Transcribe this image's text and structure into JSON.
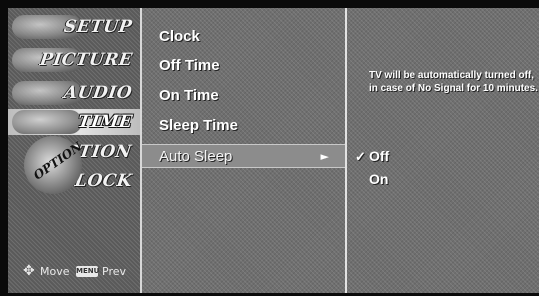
{
  "sidebar": {
    "items": [
      {
        "label": "SETUP"
      },
      {
        "label": "PICTURE"
      },
      {
        "label": "AUDIO"
      },
      {
        "label": "TIME"
      },
      {
        "label": "OPTION"
      },
      {
        "label": "LOCK"
      }
    ],
    "active": "TIME",
    "option_stamp": "OPTION"
  },
  "footer": {
    "move_label": "Move",
    "menu_key_label": "MENU",
    "prev_label": "Prev"
  },
  "menu": {
    "items": [
      {
        "label": "Clock"
      },
      {
        "label": "Off Time"
      },
      {
        "label": "On Time"
      },
      {
        "label": "Sleep Time"
      },
      {
        "label": "Auto Sleep"
      }
    ],
    "selected": "Auto Sleep",
    "arrow": "►"
  },
  "panel": {
    "message": "TV will be automatically turned off, in case of No Signal for 10 minutes.",
    "options": [
      {
        "label": "Off",
        "checked": true
      },
      {
        "label": "On",
        "checked": false
      }
    ],
    "check_glyph": "✓"
  }
}
